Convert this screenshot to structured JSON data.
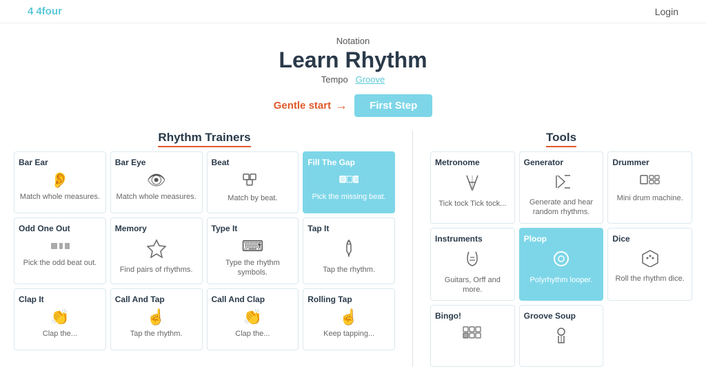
{
  "header": {
    "logo_symbol": "4",
    "logo_text": "4four",
    "login_label": "Login"
  },
  "hero": {
    "notation_label": "Notation",
    "title": "Learn Rhythm",
    "tempo_label": "Tempo",
    "groove_label": "Groove",
    "cta_gentle": "Gentle start",
    "cta_arrow": "→",
    "cta_button": "First Step"
  },
  "rhythm_section": {
    "title": "Rhythm Trainers",
    "cards": [
      {
        "id": "bar-ear",
        "title": "Bar Ear",
        "icon": "ear",
        "desc": "Match whole measures."
      },
      {
        "id": "bar-eye",
        "title": "Bar Eye",
        "icon": "eye",
        "desc": "Match whole measures."
      },
      {
        "id": "beat",
        "title": "Beat",
        "icon": "beat",
        "desc": "Match by beat."
      },
      {
        "id": "fill-the-gap",
        "title": "Fill The Gap",
        "icon": "gap",
        "desc": "Pick the missing beat.",
        "active": true
      },
      {
        "id": "odd-one-out",
        "title": "Odd One Out",
        "icon": "odd",
        "desc": "Pick the odd beat out."
      },
      {
        "id": "memory",
        "title": "Memory",
        "icon": "memory",
        "desc": "Find pairs of rhythms."
      },
      {
        "id": "type-it",
        "title": "Type It",
        "icon": "type",
        "desc": "Type the rhythm symbols."
      },
      {
        "id": "tap-it",
        "title": "Tap It",
        "icon": "tap",
        "desc": "Tap the rhythm."
      },
      {
        "id": "clap-it",
        "title": "Clap It",
        "icon": "clap",
        "desc": "Clap the..."
      },
      {
        "id": "call-and-tap",
        "title": "Call And Tap",
        "icon": "calltap",
        "desc": "Tap the rhythm."
      },
      {
        "id": "call-and-clap",
        "title": "Call And Clap",
        "icon": "callclap",
        "desc": "Clap the..."
      },
      {
        "id": "rolling-tap",
        "title": "Rolling Tap",
        "icon": "rollingtap",
        "desc": "Keep tapping..."
      }
    ]
  },
  "tools_section": {
    "title": "Tools",
    "cards": [
      {
        "id": "metronome",
        "title": "Metronome",
        "icon": "metronome",
        "desc": "Tick tock Tick tock..."
      },
      {
        "id": "generator",
        "title": "Generator",
        "icon": "generator",
        "desc": "Generate and hear random rhythms."
      },
      {
        "id": "drummer",
        "title": "Drummer",
        "icon": "drummer",
        "desc": "Mini drum machine."
      },
      {
        "id": "instruments",
        "title": "Instruments",
        "icon": "instruments",
        "desc": "Guitars, Orff and more."
      },
      {
        "id": "ploop",
        "title": "Ploop",
        "icon": "ploop",
        "desc": "Polyrhythm looper.",
        "active": true
      },
      {
        "id": "dice",
        "title": "Dice",
        "icon": "dice",
        "desc": "Roll the rhythm dice."
      },
      {
        "id": "bingo",
        "title": "Bingo!",
        "icon": "bingo",
        "desc": ""
      },
      {
        "id": "groove-soup",
        "title": "Groove Soup",
        "icon": "groove-soup",
        "desc": ""
      }
    ]
  },
  "icons": {
    "ear": "👂",
    "eye": "👁",
    "beat": "⊟",
    "gap": "▪▫▪",
    "odd": "▪▫",
    "memory": "♦",
    "type": "⌨",
    "tap": "☝",
    "clap": "👏",
    "calltap": "☝",
    "callclap": "👏",
    "rollingtap": "☝",
    "metronome": "Y",
    "generator": "✂",
    "drummer": "▣",
    "instruments": "⌥",
    "ploop": "○",
    "dice": "⬡",
    "bingo": "▦",
    "groove-soup": "♟"
  }
}
